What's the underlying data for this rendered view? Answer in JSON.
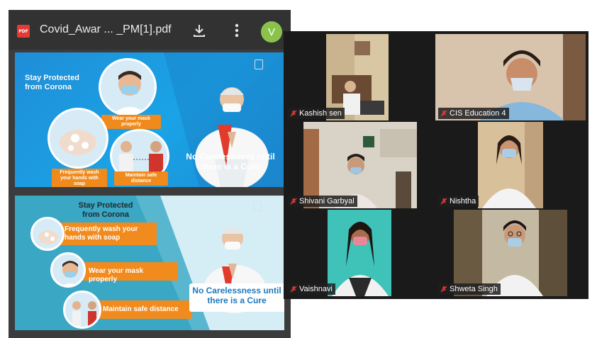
{
  "pdf_viewer": {
    "badge": "PDF",
    "filename": "Covid_Awar ... _PM[1].pdf",
    "download_icon": "download-icon",
    "more_icon": "more-vert-icon",
    "avatar_letter": "V"
  },
  "poster1": {
    "headline": "Stay Protected from Corona",
    "wear_mask": "Wear your mask properly",
    "wash_hands": "Frequently wash your hands with soap",
    "distance": "Maintain safe distance",
    "slogan": "No Carelessness until there is a Cure"
  },
  "poster2": {
    "headline": "Stay Protected from Corona",
    "wash_hands": "Frequently wash your hands with soap",
    "wear_mask": "Wear your mask properly",
    "distance": "Maintain safe distance",
    "slogan": "No Carelessness until there is a Cure"
  },
  "participants": [
    {
      "name": "Kashish sen"
    },
    {
      "name": "CIS Education 4"
    },
    {
      "name": "Shivani Garbyal"
    },
    {
      "name": "Nishtha"
    },
    {
      "name": "Vaishnavi"
    },
    {
      "name": "Shweta Singh"
    }
  ],
  "colors": {
    "accent_active": "#c7dd3a",
    "poster_orange": "#f28b1e",
    "mic_muted": "#e53935"
  }
}
